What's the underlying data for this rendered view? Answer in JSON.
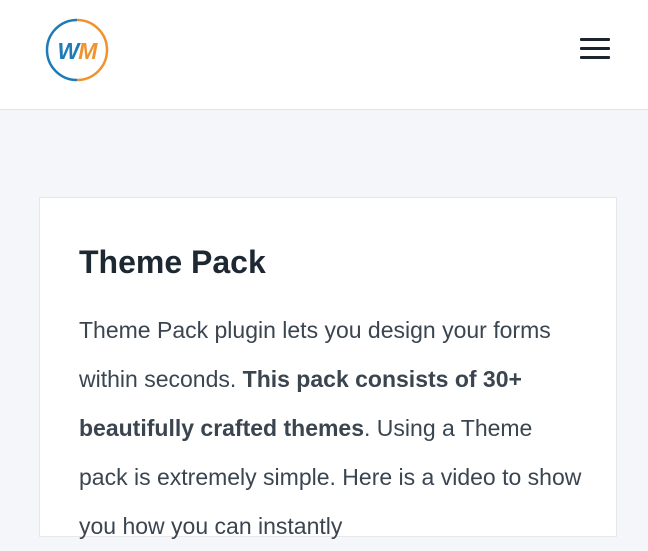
{
  "header": {
    "logo_text": "WM",
    "colors": {
      "logo_blue": "#1f7ab8",
      "logo_orange": "#f0932e",
      "menu_icon": "#1c2430"
    }
  },
  "card": {
    "title": "Theme Pack",
    "body": {
      "text_1": "Theme Pack plugin lets you design your forms within seconds. ",
      "bold_1": "This pack consists of 30+ beautifully crafted themes",
      "text_2": ". Using a Theme pack is extremely simple. Here is a video to show you how you can instantly"
    }
  }
}
